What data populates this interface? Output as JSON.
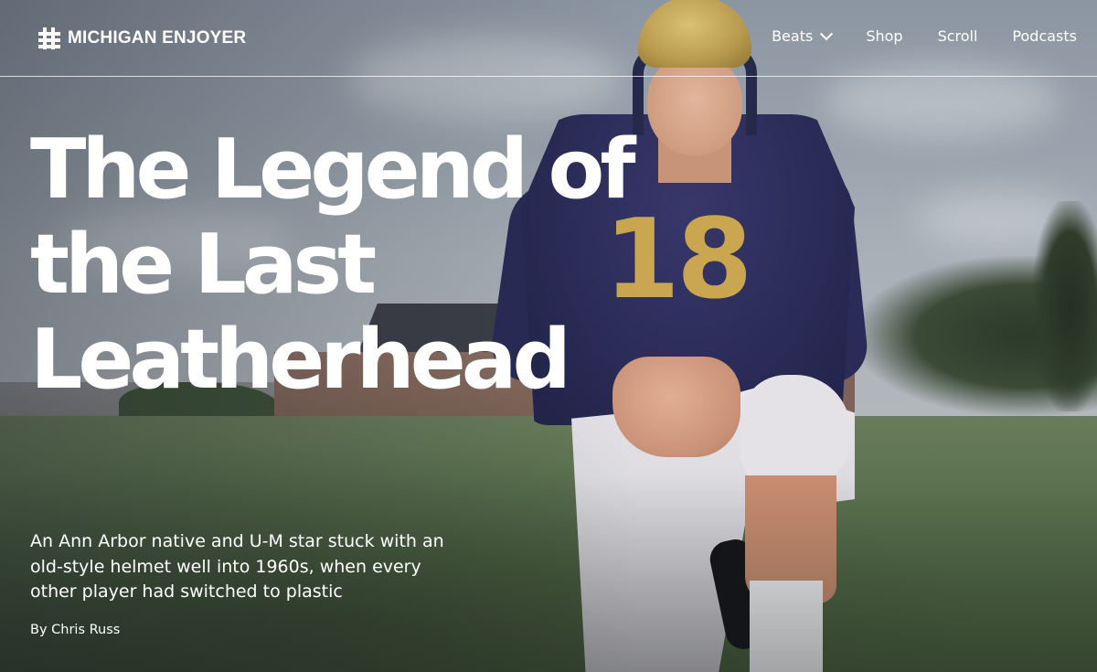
{
  "brand": {
    "name": "MICHIGAN ENJOYER",
    "logo_icon": "hash-grid-icon"
  },
  "nav": {
    "items": [
      {
        "label": "Beats",
        "icon": "chevron-down-icon"
      },
      {
        "label": "Shop"
      },
      {
        "label": "Scroll"
      },
      {
        "label": "Podcasts"
      }
    ]
  },
  "article": {
    "title_lines": [
      "The Legend of",
      "the Last",
      "Leatherhead"
    ],
    "dek_lines": [
      "An Ann Arbor native and U-M star stuck with an",
      "old-style helmet well into 1960s, when every",
      "other player had switched to plastic"
    ],
    "byline": "By Chris Russ"
  },
  "hero_image": {
    "jersey_number": "18",
    "colors": {
      "jersey": "#2b2c58",
      "helmet": "#c9a64f",
      "field": "#5d7350",
      "sky": "#9aa3ad"
    }
  }
}
